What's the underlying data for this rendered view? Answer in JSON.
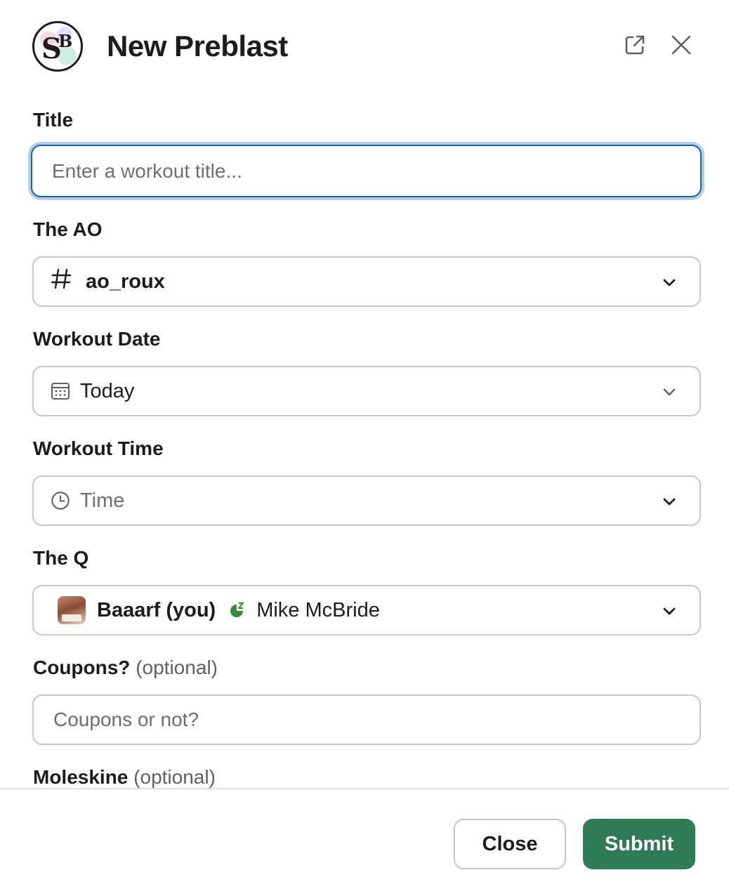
{
  "modal": {
    "title": "New Preblast",
    "logo_text": "SB"
  },
  "header": {
    "open_icon": "external-link-icon",
    "close_icon": "close-icon"
  },
  "fields": {
    "title": {
      "label": "Title",
      "placeholder": "Enter a workout title..."
    },
    "ao": {
      "label": "The AO",
      "icon": "hash-icon",
      "value": "ao_roux"
    },
    "date": {
      "label": "Workout Date",
      "icon": "calendar-icon",
      "value": "Today"
    },
    "time": {
      "label": "Workout Time",
      "icon": "clock-icon",
      "placeholder": "Time"
    },
    "q": {
      "label": "The Q",
      "user_name": "Baaarf (you)",
      "status_icon": "status-emoji-icon",
      "full_name": "Mike McBride"
    },
    "coupons": {
      "label": "Coupons?",
      "optional": "(optional)",
      "placeholder": "Coupons or not?"
    },
    "moleskine": {
      "label": "Moleskine",
      "optional": "(optional)"
    }
  },
  "footer": {
    "close_label": "Close",
    "submit_label": "Submit"
  },
  "colors": {
    "submit_bg": "#2f7a57",
    "focus_border": "#1264a3",
    "border": "#c6c6c7"
  }
}
